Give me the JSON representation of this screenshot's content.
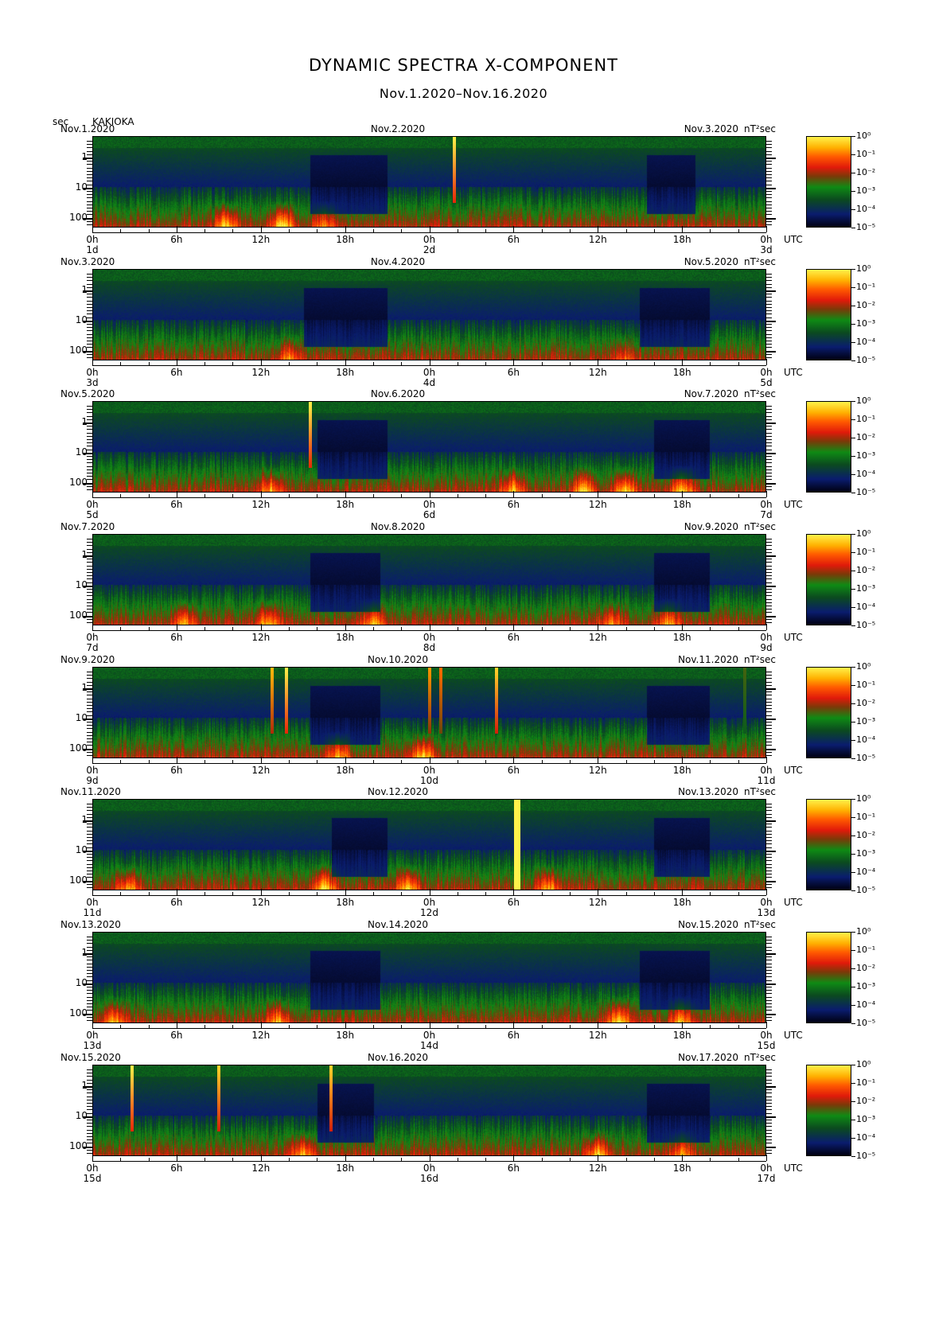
{
  "title": "DYNAMIC SPECTRA X-COMPONENT",
  "subtitle": "Nov.1.2020–Nov.16.2020",
  "y_unit_label": "sec",
  "station": "KAKIOKA",
  "colorbar_unit": "nT²sec",
  "colorbar_labels": [
    "10⁰",
    "10⁻¹",
    "10⁻²",
    "10⁻³",
    "10⁻⁴",
    "10⁻⁵"
  ],
  "utc_label": "UTC",
  "x_ticks": [
    "0h",
    "6h",
    "12h",
    "18h",
    "0h",
    "6h",
    "12h",
    "18h",
    "0h"
  ],
  "y_ticks": [
    "1",
    "10",
    "100"
  ],
  "panels": [
    {
      "left_date": "Nov.1.2020",
      "mid_date": "Nov.2.2020",
      "right_date": "Nov.3.2020",
      "day_left": "1d",
      "day_mid": "2d",
      "day_right": "3d"
    },
    {
      "left_date": "Nov.3.2020",
      "mid_date": "Nov.4.2020",
      "right_date": "Nov.5.2020",
      "day_left": "3d",
      "day_mid": "4d",
      "day_right": "5d"
    },
    {
      "left_date": "Nov.5.2020",
      "mid_date": "Nov.6.2020",
      "right_date": "Nov.7.2020",
      "day_left": "5d",
      "day_mid": "6d",
      "day_right": "7d"
    },
    {
      "left_date": "Nov.7.2020",
      "mid_date": "Nov.8.2020",
      "right_date": "Nov.9.2020",
      "day_left": "7d",
      "day_mid": "8d",
      "day_right": "9d"
    },
    {
      "left_date": "Nov.9.2020",
      "mid_date": "Nov.10.2020",
      "right_date": "Nov.11.2020",
      "day_left": "9d",
      "day_mid": "10d",
      "day_right": "11d"
    },
    {
      "left_date": "Nov.11.2020",
      "mid_date": "Nov.12.2020",
      "right_date": "Nov.13.2020",
      "day_left": "11d",
      "day_mid": "12d",
      "day_right": "13d"
    },
    {
      "left_date": "Nov.13.2020",
      "mid_date": "Nov.14.2020",
      "right_date": "Nov.15.2020",
      "day_left": "13d",
      "day_mid": "14d",
      "day_right": "15d"
    },
    {
      "left_date": "Nov.15.2020",
      "mid_date": "Nov.16.2020",
      "right_date": "Nov.17.2020",
      "day_left": "15d",
      "day_mid": "16d",
      "day_right": "17d"
    }
  ],
  "chart_data": {
    "type": "heatmap",
    "title": "DYNAMIC SPECTRA X-COMPONENT",
    "subtitle": "Nov.1.2020–Nov.16.2020",
    "xlabel": "UTC",
    "ylabel": "sec",
    "y_scale": "log",
    "y_ticks": [
      1,
      10,
      100
    ],
    "colorbar": {
      "label": "nT²sec",
      "scale": "log",
      "range": [
        1e-05,
        1
      ]
    },
    "x_range_hours_per_panel": [
      0,
      48
    ],
    "panels": [
      {
        "start": "Nov.1.2020",
        "end": "Nov.3.2020",
        "spikes": [
          {
            "hour": 25.8,
            "intensity": 1.0
          }
        ],
        "bursts": [
          {
            "hour": 9.5,
            "level": 0.6
          },
          {
            "hour": 13.5,
            "level": 0.7
          },
          {
            "hour": 16.5,
            "level": 0.4
          }
        ],
        "quiet": [
          [
            15.5,
            21
          ],
          [
            39.5,
            43
          ]
        ]
      },
      {
        "start": "Nov.3.2020",
        "end": "Nov.5.2020",
        "spikes": [],
        "bursts": [
          {
            "hour": 14,
            "level": 0.4
          },
          {
            "hour": 38,
            "level": 0.3
          }
        ],
        "quiet": [
          [
            15,
            21
          ],
          [
            39,
            44
          ]
        ]
      },
      {
        "start": "Nov.5.2020",
        "end": "Nov.7.2020",
        "spikes": [
          {
            "hour": 15.5,
            "intensity": 1.0
          }
        ],
        "bursts": [
          {
            "hour": 12.7,
            "level": 0.5
          },
          {
            "hour": 30,
            "level": 0.5
          },
          {
            "hour": 35,
            "level": 0.6
          },
          {
            "hour": 38,
            "level": 0.6
          },
          {
            "hour": 42,
            "level": 0.6
          }
        ],
        "quiet": [
          [
            16,
            21
          ],
          [
            40,
            44
          ]
        ]
      },
      {
        "start": "Nov.7.2020",
        "end": "Nov.9.2020",
        "spikes": [],
        "bursts": [
          {
            "hour": 6.5,
            "level": 0.5
          },
          {
            "hour": 12.5,
            "level": 0.5
          },
          {
            "hour": 20,
            "level": 0.5
          },
          {
            "hour": 37,
            "level": 0.4
          },
          {
            "hour": 41,
            "level": 0.5
          }
        ],
        "quiet": [
          [
            15.5,
            20.5
          ],
          [
            40,
            44
          ]
        ]
      },
      {
        "start": "Nov.9.2020",
        "end": "Nov.11.2020",
        "spikes": [
          {
            "hour": 12.8,
            "intensity": 0.9
          },
          {
            "hour": 13.8,
            "intensity": 1.0
          },
          {
            "hour": 24.0,
            "intensity": 0.85
          },
          {
            "hour": 24.8,
            "intensity": 0.8
          },
          {
            "hour": 28.8,
            "intensity": 0.95
          },
          {
            "hour": 46.5,
            "intensity": 0.5
          }
        ],
        "bursts": [
          {
            "hour": 17.5,
            "level": 0.5
          },
          {
            "hour": 23.5,
            "level": 0.6
          }
        ],
        "quiet": [
          [
            15.5,
            20.5
          ],
          [
            39.5,
            44
          ]
        ]
      },
      {
        "start": "Nov.11.2020",
        "end": "Nov.13.2020",
        "spikes": [
          {
            "hour": 30.3,
            "intensity": 1.0,
            "wide": true
          }
        ],
        "bursts": [
          {
            "hour": 2.5,
            "level": 0.5
          },
          {
            "hour": 16.5,
            "level": 0.6
          },
          {
            "hour": 22.5,
            "level": 0.6
          },
          {
            "hour": 32.5,
            "level": 0.5
          }
        ],
        "quiet": [
          [
            17,
            21
          ],
          [
            40,
            44
          ]
        ]
      },
      {
        "start": "Nov.13.2020",
        "end": "Nov.15.2020",
        "spikes": [],
        "bursts": [
          {
            "hour": 1.5,
            "level": 0.5
          },
          {
            "hour": 13.2,
            "level": 0.5
          },
          {
            "hour": 37.5,
            "level": 0.6
          },
          {
            "hour": 42,
            "level": 0.5
          }
        ],
        "quiet": [
          [
            15.5,
            20.5
          ],
          [
            39,
            44
          ]
        ]
      },
      {
        "start": "Nov.15.2020",
        "end": "Nov.17.2020",
        "spikes": [
          {
            "hour": 2.8,
            "intensity": 1.0
          },
          {
            "hour": 9.0,
            "intensity": 0.95
          },
          {
            "hour": 17.0,
            "intensity": 0.95
          }
        ],
        "bursts": [
          {
            "hour": 15,
            "level": 0.5
          },
          {
            "hour": 36,
            "level": 0.6
          },
          {
            "hour": 42,
            "level": 0.4
          }
        ],
        "quiet": [
          [
            16,
            20
          ],
          [
            39.5,
            44
          ]
        ]
      }
    ]
  }
}
